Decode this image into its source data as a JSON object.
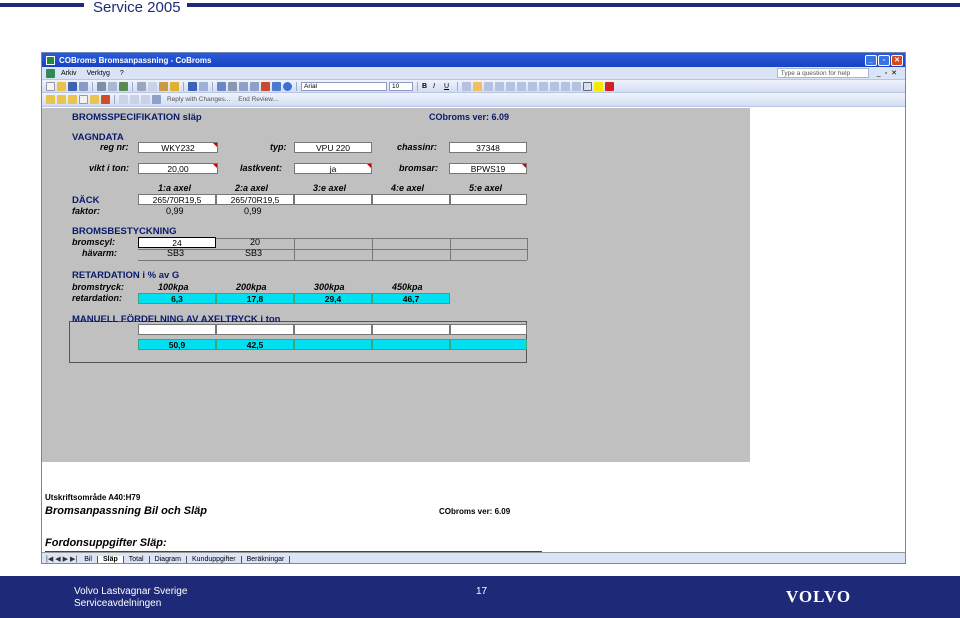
{
  "slide": {
    "title": "Service 2005",
    "footer_company": "Volvo Lastvagnar Sverige",
    "footer_department": "Serviceavdelningen",
    "page_number": "17",
    "logo_text": "VOLVO",
    "brand_color": "#1e2a78"
  },
  "excel": {
    "window_title": "COBroms Bromsanpassning - CoBroms",
    "menu": [
      "Arkiv",
      "Verktyg",
      "?"
    ],
    "help_placeholder": "Type a question for help",
    "font_name": "Arial",
    "font_size": "10",
    "reviewing_label": "Reply with Changes...",
    "end_review_label": "End Review...",
    "sheet": {
      "header_title": "BROMSSPECIFIKATION släp",
      "version": "CObroms ver: 6.09",
      "vagndata_label": "VAGNDATA",
      "reg_nr_label": "reg nr:",
      "reg_nr_value": "WKY232",
      "typ_label": "typ:",
      "typ_value": "VPU 220",
      "chassinr_label": "chassinr:",
      "chassinr_value": "37348",
      "vikt_label": "vikt i ton:",
      "vikt_value": "20,00",
      "lastkvent_label": "lastkvent:",
      "lastkvent_value": "ja",
      "bromsar_label": "bromsar:",
      "bromsar_value": "BPWS19",
      "axel_headers": [
        "1:a axel",
        "2:a axel",
        "3:e axel",
        "4:e axel",
        "5:e axel"
      ],
      "dack_label": "DÄCK",
      "dack_values": [
        "265/70R19,5",
        "265/70R19,5",
        "",
        "",
        ""
      ],
      "faktor_label": "faktor:",
      "faktor_values": [
        "0,99",
        "0,99"
      ],
      "bromsbestyckning_label": "BROMSBESTYCKNING",
      "bromscyl_label": "bromscyl:",
      "bromscyl_values": [
        "24",
        "20",
        "",
        "",
        ""
      ],
      "havarm_label": "hävarm:",
      "havarm_values": [
        "SB3",
        "SB3",
        "",
        "",
        ""
      ],
      "retardation_title": "RETARDATION i % av G",
      "bromstryck_label": "bromstryck:",
      "pressures": [
        "100kpa",
        "200kpa",
        "300kpa",
        "450kpa"
      ],
      "retardation_label": "retardation:",
      "retardation_values": [
        "6,3",
        "17,8",
        "29,4",
        "46,7"
      ],
      "manuell_label": "MANUELL FÖRDELNING AV AXELTRYCK i ton",
      "manuell_values": [
        "50,9",
        "42,5",
        "",
        "",
        ""
      ]
    },
    "print_area": {
      "range_label": "Utskriftsområde A40:H79",
      "title": "Bromsanpassning Bil och Släp",
      "version": "CObroms ver: 6.09",
      "section": "Fordonsuppgifter Släp:"
    },
    "tabs": [
      "Bil",
      "Släp",
      "Total",
      "Diagram",
      "Kunduppgifter",
      "Beräkningar"
    ],
    "active_tab": "Släp"
  }
}
